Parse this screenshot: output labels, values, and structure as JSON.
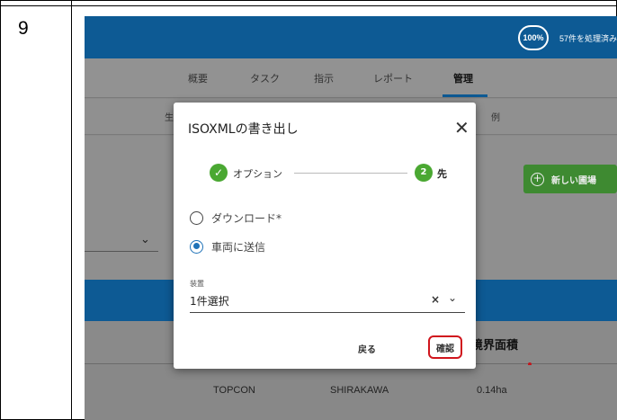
{
  "step": {
    "number": "9"
  },
  "header": {
    "progress": "100%",
    "processed": "57件を処理済み"
  },
  "nav": {
    "tabs": [
      "概要",
      "タスク",
      "指示",
      "レポート",
      "管理"
    ],
    "active": "管理"
  },
  "subtabs": {
    "left": "生",
    "right": "例"
  },
  "page": {
    "new_field_button": "新しい圃場"
  },
  "table": {
    "area_header": "境界面積",
    "row": [
      "TOPCON",
      "SHIRAKAWA",
      "0.14ha"
    ]
  },
  "dialog": {
    "title": "ISOXMLの書き出し",
    "steps": [
      {
        "label": "オプション",
        "state": "done"
      },
      {
        "number": "2",
        "label": "先",
        "state": "active"
      }
    ],
    "options": [
      {
        "label": "ダウンロード*",
        "checked": false
      },
      {
        "label": "車両に送信",
        "checked": true
      }
    ],
    "field": {
      "label": "装置",
      "value": "1件選択"
    },
    "back": "戻る",
    "confirm": "確認"
  },
  "colors": {
    "brand_blue": "#0d5a94",
    "green": "#4aa832",
    "radio_blue": "#1f72b8",
    "highlight_red": "#d0151d"
  }
}
